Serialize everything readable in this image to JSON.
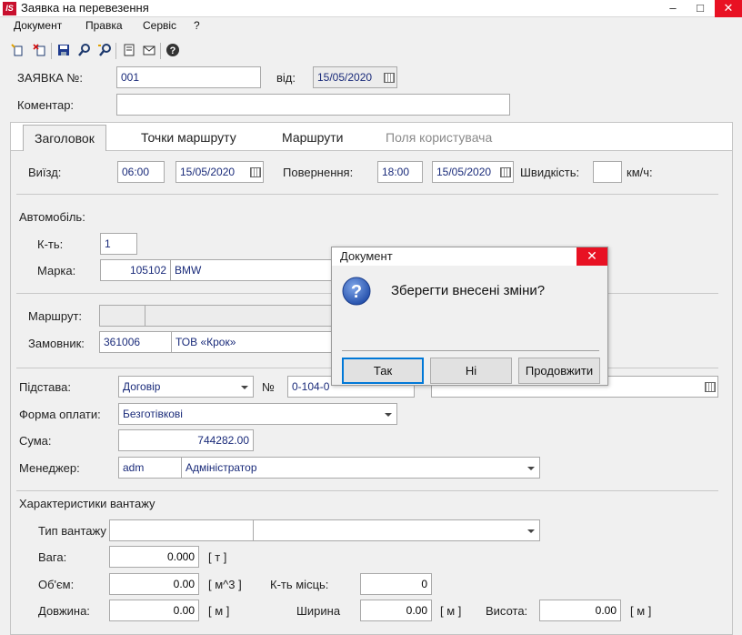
{
  "window": {
    "title": "Заявка на перевезення",
    "logo": "IS"
  },
  "menu": [
    "Документ",
    "Правка",
    "Сервіс",
    "?"
  ],
  "toolbar": {
    "icons": [
      "new-doc-icon",
      "delete-doc-icon",
      "save-icon",
      "find-icon",
      "find-next-icon",
      "properties-icon",
      "mail-icon",
      "help-icon"
    ]
  },
  "header": {
    "order_label": "ЗАЯВКА №:",
    "order_value": "001",
    "from_label": "від:",
    "from_date": "15/05/2020",
    "comment_label": "Коментар:",
    "comment_value": ""
  },
  "tabs": [
    {
      "label": "Заголовок",
      "active": true
    },
    {
      "label": "Точки маршруту"
    },
    {
      "label": "Маршрути"
    },
    {
      "label": "Поля користувача",
      "disabled": true
    }
  ],
  "trip": {
    "depart_label": "Виїзд:",
    "depart_time": "06:00",
    "depart_date": "15/05/2020",
    "return_label": "Повернення:",
    "return_time": "18:00",
    "return_date": "15/05/2020",
    "speed_label": "Швидкість:",
    "speed_value": "",
    "speed_unit": "км/ч:"
  },
  "vehicle": {
    "section_label": "Автомобіль:",
    "count_label": "К-ть:",
    "count_value": "1",
    "brand_label": "Марка:",
    "brand_code": "105102",
    "brand_name": "BMW"
  },
  "route": {
    "route_label": "Маршрут:",
    "customer_label": "Замовник:",
    "customer_code": "361006",
    "customer_name": "ТОВ «Крок»"
  },
  "basis": {
    "basis_label": "Підстава:",
    "basis_value": "Договір",
    "number_label": "№",
    "number_value": "0-104-0",
    "payment_label": "Форма оплати:",
    "payment_value": "Безготівкові",
    "sum_label": "Сума:",
    "sum_value": "744282.00",
    "manager_label": "Менеджер:",
    "manager_code": "adm",
    "manager_name": "Адміністратор"
  },
  "cargo": {
    "section_label": "Характеристики вантажу",
    "type_label": "Тип вантажу",
    "weight_label": "Вага:",
    "weight_value": "0.000",
    "weight_unit": "[ т ]",
    "volume_label": "Об'єм:",
    "volume_value": "0.00",
    "volume_unit": "[ м^3 ]",
    "places_label": "К-ть місць:",
    "places_value": "0",
    "length_label": "Довжина:",
    "length_value": "0.00",
    "length_unit": "[ м ]",
    "width_label": "Ширина",
    "width_value": "0.00",
    "width_unit": "[ м ]",
    "height_label": "Висота:",
    "height_value": "0.00",
    "height_unit": "[ м ]"
  },
  "dialog": {
    "title": "Документ",
    "message": "Зберегти внесені зміни?",
    "yes": "Так",
    "no": "Ні",
    "continue": "Продовжити"
  }
}
